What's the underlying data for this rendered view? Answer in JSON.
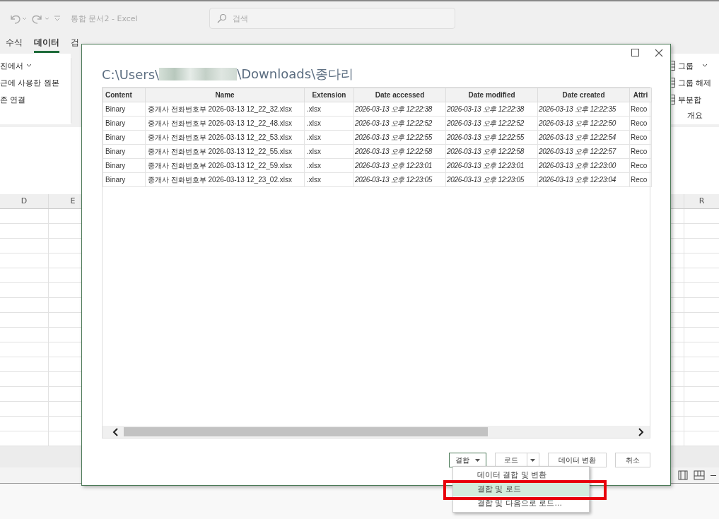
{
  "app_window": {
    "title": "통합 문서2 - Excel",
    "search": {
      "placeholder": "검색"
    }
  },
  "ribbon": {
    "tabs": [
      {
        "label": "수식",
        "selected": false
      },
      {
        "label": "데이터",
        "selected": true
      },
      {
        "label": "검",
        "selected": false
      }
    ],
    "left_commands": [
      "진에서",
      "근에 사용한 원본",
      "존 연결"
    ],
    "right_commands": [
      "그룹",
      "그룹 해제",
      "부분합"
    ],
    "right_group_label": "개요"
  },
  "sheet": {
    "left_columns": [
      "D",
      "E"
    ],
    "right_columns": [
      "R"
    ]
  },
  "dialog": {
    "path_start": "C:\\Users\\",
    "path_end": "\\Downloads\\종다리",
    "table": {
      "columns": [
        "Content",
        "Name",
        "Extension",
        "Date accessed",
        "Date modified",
        "Date created",
        "Attri"
      ],
      "rows": [
        [
          "Binary",
          "중개사 전화번호부 2026-03-13 12_22_32.xlsx",
          ".xlsx",
          "2026-03-13 오후 12:22:38",
          "2026-03-13 오후 12:22:38",
          "2026-03-13 오후 12:22:35",
          "Reco"
        ],
        [
          "Binary",
          "중개사 전화번호부 2026-03-13 12_22_48.xlsx",
          ".xlsx",
          "2026-03-13 오후 12:22:52",
          "2026-03-13 오후 12:22:52",
          "2026-03-13 오후 12:22:50",
          "Reco"
        ],
        [
          "Binary",
          "중개사 전화번호부 2026-03-13 12_22_53.xlsx",
          ".xlsx",
          "2026-03-13 오후 12:22:55",
          "2026-03-13 오후 12:22:55",
          "2026-03-13 오후 12:22:54",
          "Reco"
        ],
        [
          "Binary",
          "중개사 전화번호부 2026-03-13 12_22_55.xlsx",
          ".xlsx",
          "2026-03-13 오후 12:22:58",
          "2026-03-13 오후 12:22:58",
          "2026-03-13 오후 12:22:57",
          "Reco"
        ],
        [
          "Binary",
          "중개사 전화번호부 2026-03-13 12_22_59.xlsx",
          ".xlsx",
          "2026-03-13 오후 12:23:01",
          "2026-03-13 오후 12:23:01",
          "2026-03-13 오후 12:23:00",
          "Reco"
        ],
        [
          "Binary",
          "중개사 전화번호부 2026-03-13 12_23_02.xlsx",
          ".xlsx",
          "2026-03-13 오후 12:23:05",
          "2026-03-13 오후 12:23:05",
          "2026-03-13 오후 12:23:04",
          "Reco"
        ]
      ]
    },
    "buttons": [
      {
        "label": "결합",
        "kind": "dropdown"
      },
      {
        "label": "로드",
        "kind": "split"
      },
      {
        "label": "데이터 변환",
        "kind": "plain"
      },
      {
        "label": "취소",
        "kind": "plain"
      }
    ],
    "menu": [
      {
        "label": "데이터 결합 및 변환",
        "selected": false
      },
      {
        "label": "결합 및 로드",
        "selected": true
      },
      {
        "label": "결합 및 다음으로 로드...",
        "selected": false
      }
    ]
  }
}
